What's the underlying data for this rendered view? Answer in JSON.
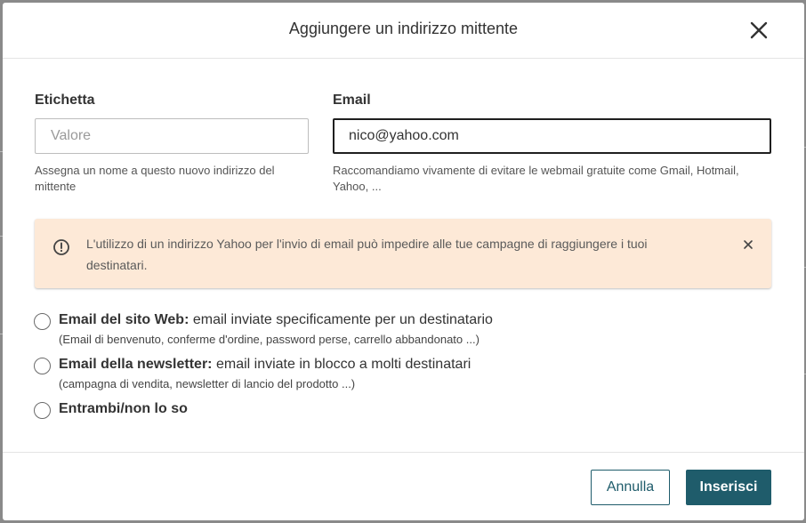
{
  "modal": {
    "title": "Aggiungere un indirizzo mittente"
  },
  "form": {
    "label_field": {
      "label": "Etichetta",
      "value": "",
      "placeholder": "Valore",
      "help": "Assegna un nome a questo nuovo indirizzo del mittente"
    },
    "email_field": {
      "label": "Email",
      "value": "nico@yahoo.com",
      "placeholder": "",
      "help": "Raccomandiamo vivamente di evitare le webmail gratuite come Gmail, Hotmail, Yahoo, ..."
    }
  },
  "alert": {
    "text": "L'utilizzo di un indirizzo Yahoo per l'invio di email può impedire alle tue campagne di raggiungere i tuoi destinatari.",
    "icon": "info-circle-icon"
  },
  "options": [
    {
      "title": "Email del sito Web:",
      "desc": " email inviate specificamente per un destinatario",
      "sub": "(Email di benvenuto, conferme d'ordine, password perse, carrello abbandonato ...)"
    },
    {
      "title": "Email della newsletter:",
      "desc": " email inviate in blocco a molti destinatari",
      "sub": "(campagna di vendita, newsletter di lancio del prodotto ...)"
    },
    {
      "title": "Entrambi/non lo so",
      "desc": "",
      "sub": ""
    }
  ],
  "footer": {
    "cancel_label": "Annulla",
    "submit_label": "Inserisci"
  },
  "colors": {
    "primary": "#1f5c6b",
    "alert_bg": "#fde9d7"
  }
}
